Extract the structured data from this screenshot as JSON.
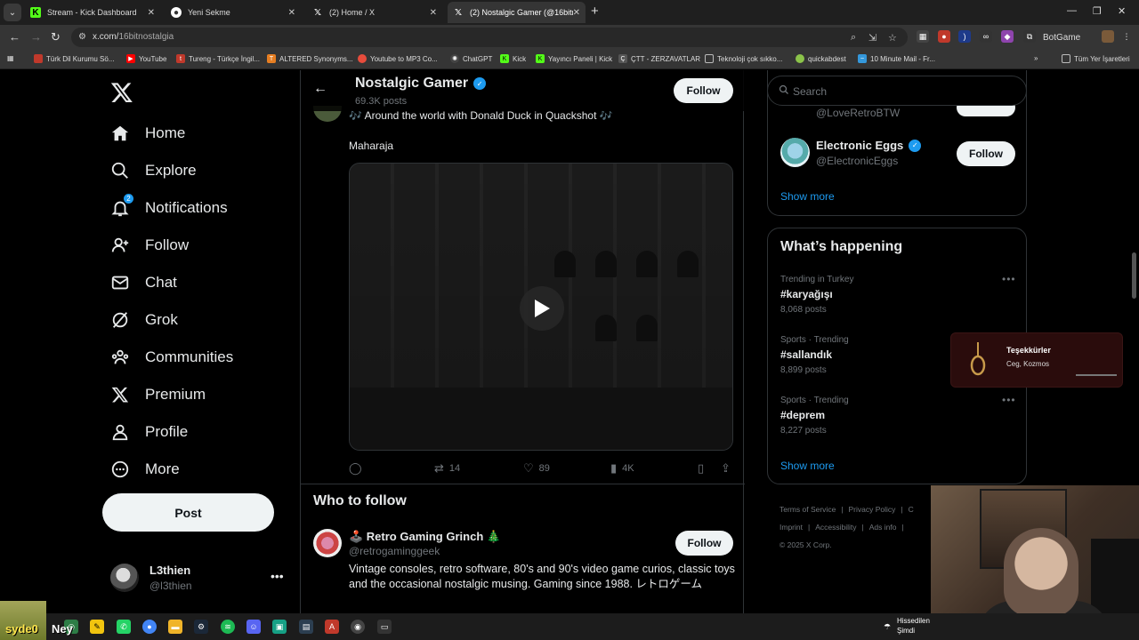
{
  "browser": {
    "tabs": [
      {
        "label": "Stream - Kick Dashboard",
        "icon": "kick-icon",
        "active": false
      },
      {
        "label": "Yeni Sekme",
        "icon": "chrome-icon",
        "active": false
      },
      {
        "label": "(2) Home / X",
        "icon": "x-icon",
        "active": false
      },
      {
        "label": "(2) Nostalgic Gamer (@16bitno",
        "icon": "x-icon",
        "active": true
      }
    ],
    "url_host": "x.com/",
    "url_path": "16bitnostalgia",
    "extension_text": "BotGame",
    "bookmarks": [
      {
        "label": "Türk Dil Kurumu Sö...",
        "color": "#c0392b"
      },
      {
        "label": "YouTube",
        "color": "#ff0000"
      },
      {
        "label": "Tureng - Türkçe İngil...",
        "color": "#c0392b"
      },
      {
        "label": "ALTERED Synonyms...",
        "color": "#e67e22"
      },
      {
        "label": "Youtube to MP3 Co...",
        "color": "#e74c3c"
      },
      {
        "label": "ChatGPT",
        "color": "#444444"
      },
      {
        "label": "Kick",
        "color": "#53fc18"
      },
      {
        "label": "Yayıncı Paneli | Kick",
        "color": "#53fc18"
      },
      {
        "label": "ÇTT - ZERZAVATLAR",
        "color": "#555555"
      },
      {
        "label": "Teknoloji çok sıkko...",
        "color": "#555555"
      },
      {
        "label": "quickabdest",
        "color": "#8bc34a"
      },
      {
        "label": "10 Minute Mail - Fr...",
        "color": "#3498db"
      }
    ],
    "all_bookmarks": "Tüm Yer İşaretleri"
  },
  "sidebar": {
    "items": [
      {
        "label": "Home",
        "icon": "home-icon"
      },
      {
        "label": "Explore",
        "icon": "search-icon"
      },
      {
        "label": "Notifications",
        "icon": "bell-icon",
        "badge": "2"
      },
      {
        "label": "Follow",
        "icon": "add-person-icon"
      },
      {
        "label": "Chat",
        "icon": "mail-icon"
      },
      {
        "label": "Grok",
        "icon": "grok-icon"
      },
      {
        "label": "Communities",
        "icon": "people-icon"
      },
      {
        "label": "Premium",
        "icon": "x-icon"
      },
      {
        "label": "Profile",
        "icon": "person-icon"
      },
      {
        "label": "More",
        "icon": "more-icon"
      }
    ],
    "post_label": "Post",
    "user_name": "L3thien",
    "user_handle": "@l3thien"
  },
  "profile_header": {
    "name": "Nostalgic Gamer",
    "posts": "69.3K posts",
    "follow_label": "Follow"
  },
  "tweet": {
    "text": "🎶 Around the world with Donald Duck in Quackshot 🎶",
    "text2": "Maharaja",
    "replies": "",
    "reposts": "14",
    "likes": "89",
    "views": "4K"
  },
  "who_to_follow": {
    "title": "Who to follow",
    "user": {
      "name": "🕹️ Retro Gaming Grinch 🎄",
      "handle": "@retrogaminggeek",
      "bio": "Vintage consoles, retro software, 80's and 90's video game curios, classic toys and the occasional nostalgic musing. Gaming since 1988. レトロゲーム",
      "follow_label": "Follow"
    }
  },
  "right": {
    "search_placeholder": "Search",
    "prev_handle": "@LoveRetroBTW",
    "suggestion": {
      "name": "Electronic Eggs",
      "handle": "@ElectronicEggs",
      "follow_label": "Follow"
    },
    "show_more": "Show more",
    "whats_happening": "What’s happening",
    "trends": [
      {
        "meta": "Trending in Turkey",
        "tag": "#karyağışı",
        "count": "8,068 posts"
      },
      {
        "meta": "Sports · Trending",
        "tag": "#sallandık",
        "count": "8,899 posts"
      },
      {
        "meta": "Sports · Trending",
        "tag": "#deprem",
        "count": "8,227 posts"
      }
    ],
    "show_more_2": "Show more",
    "footer": [
      "Terms of Service",
      "|",
      "Privacy Policy",
      "|",
      "C",
      "Imprint",
      "|",
      "Accessibility",
      "|",
      "Ads info",
      "|",
      "© 2025 X Corp."
    ]
  },
  "overlay": {
    "notification_title": "Teşekkürler",
    "notification_text": "Ceg, Kozmos",
    "chat_user": "syde0",
    "chat_msg": "Ney",
    "clock_line1": "Hissedilen",
    "clock_line2": "Şimdi"
  }
}
